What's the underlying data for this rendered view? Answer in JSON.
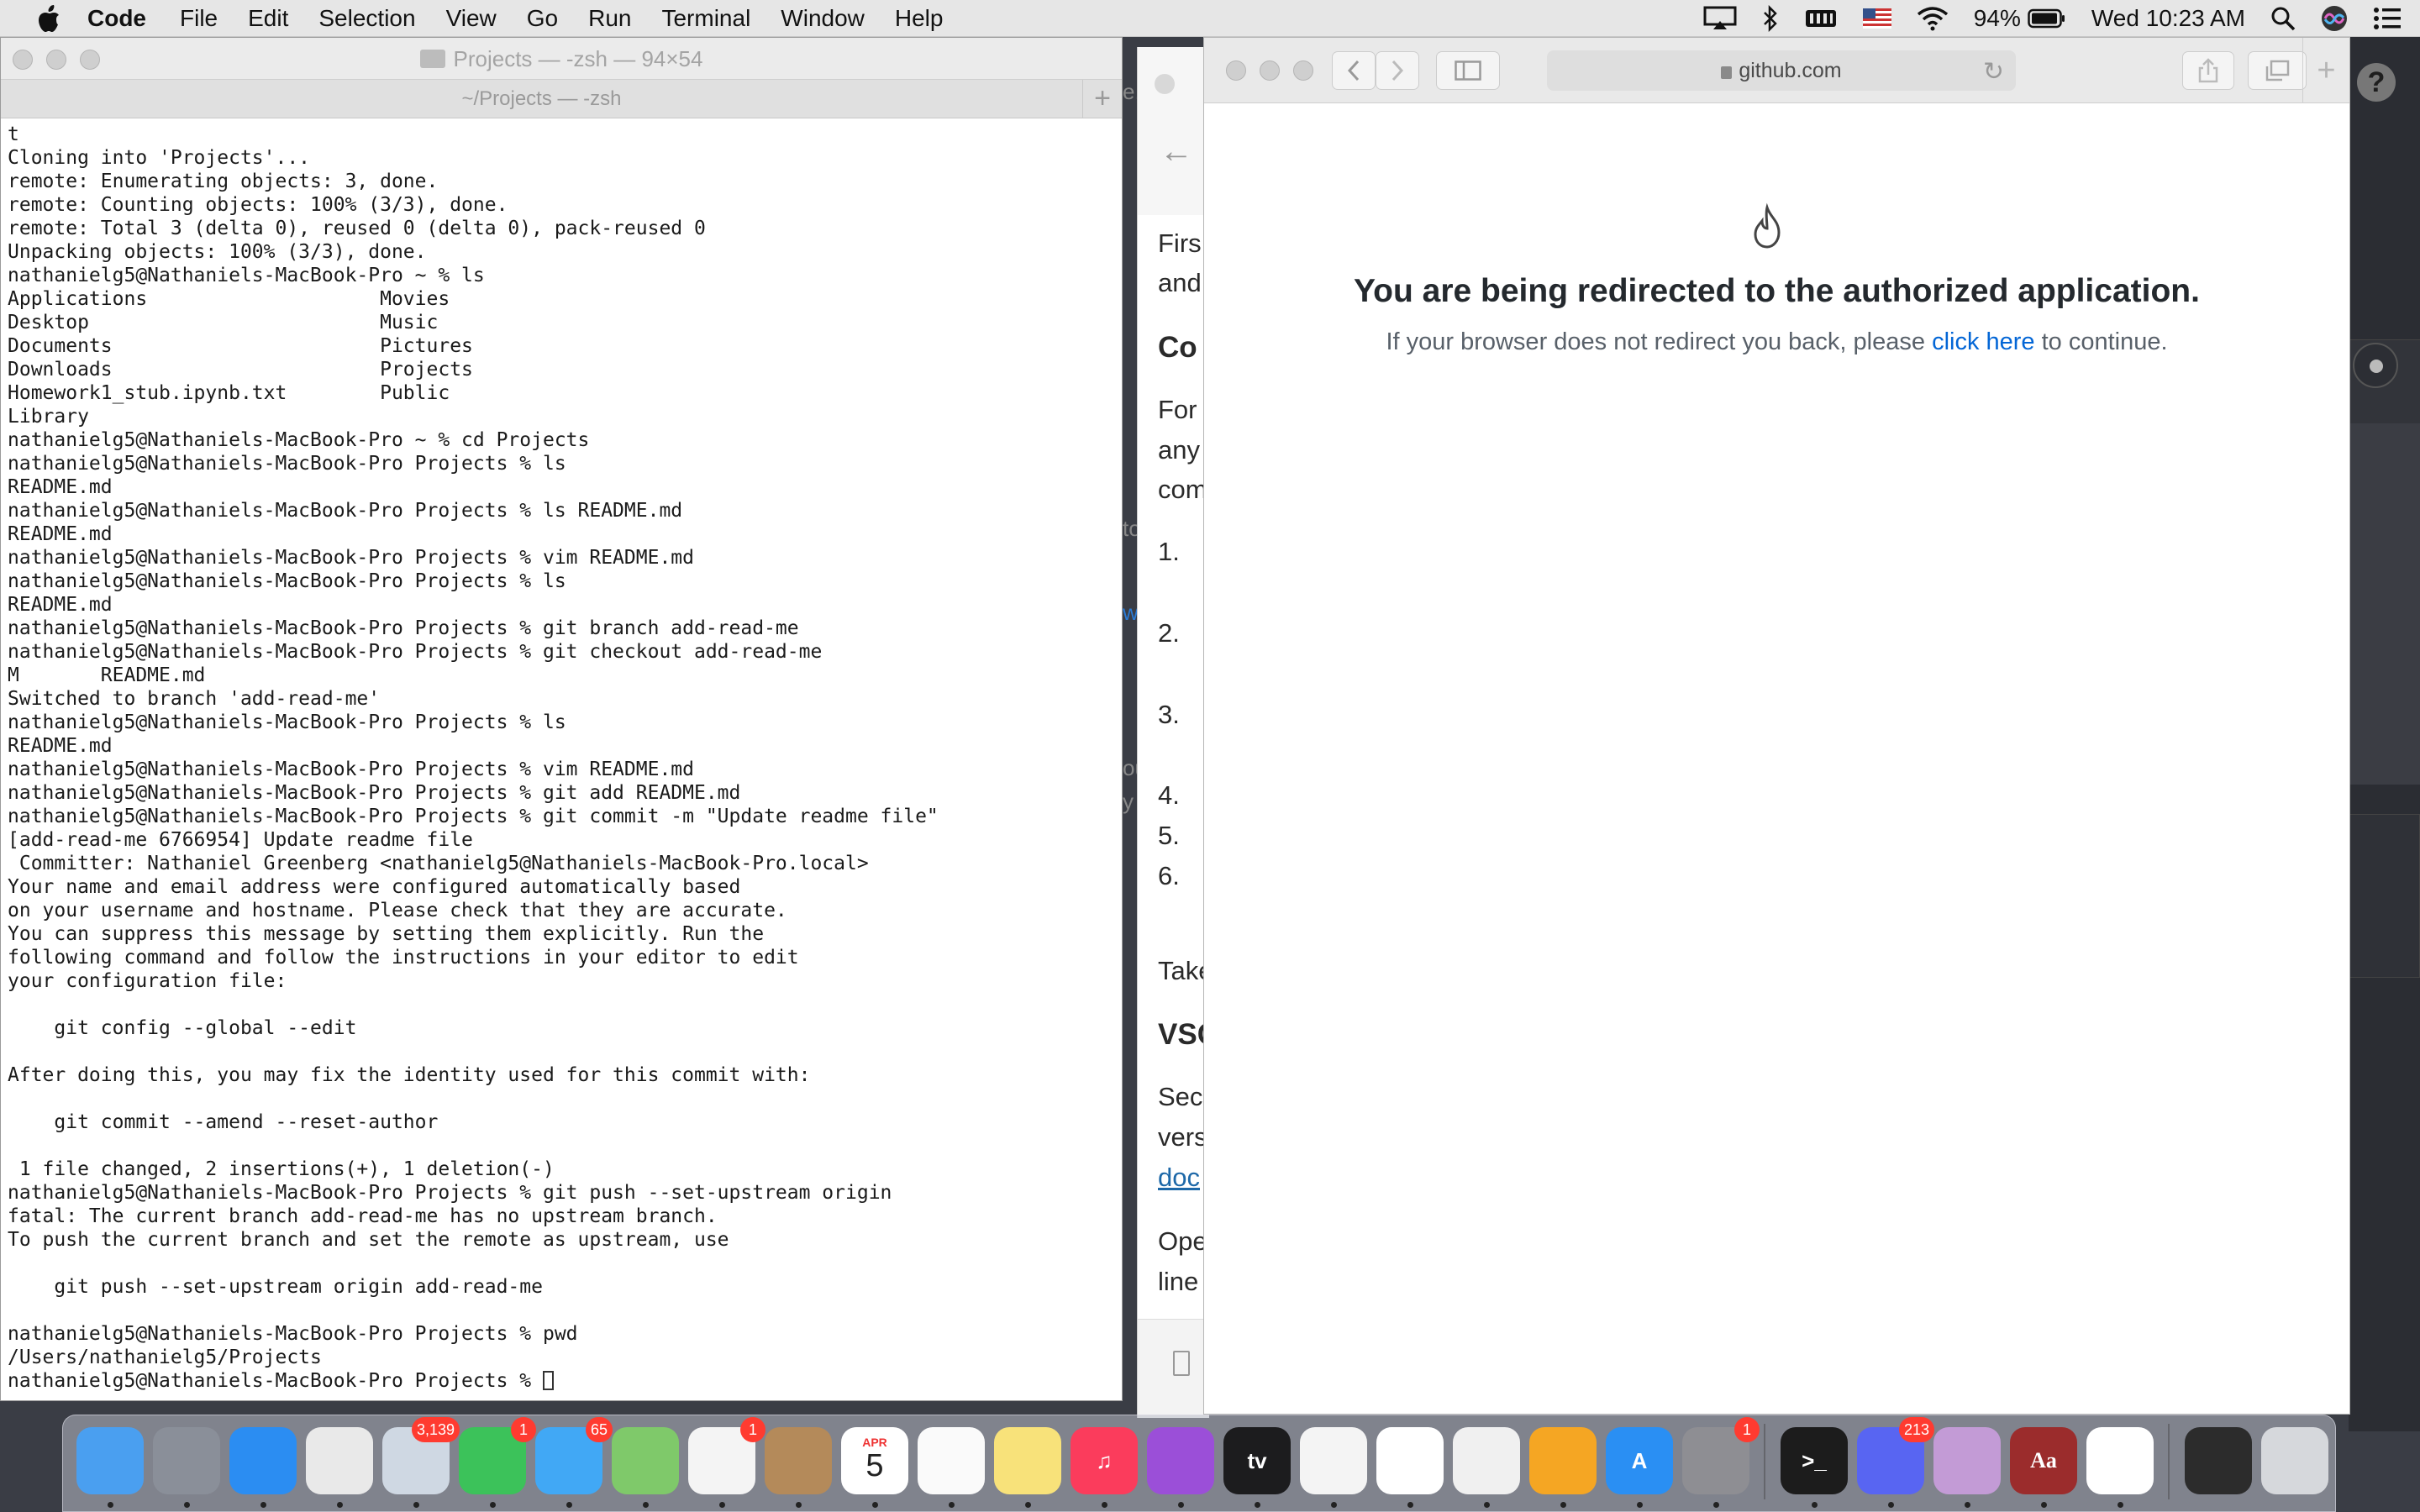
{
  "menubar": {
    "app_name": "Code",
    "items": [
      "File",
      "Edit",
      "Selection",
      "View",
      "Go",
      "Run",
      "Terminal",
      "Window",
      "Help"
    ],
    "battery": "94%",
    "clock": "Wed 10:23 AM"
  },
  "terminal": {
    "title": "Projects — -zsh — 94×54",
    "tab_title": "~/Projects — -zsh",
    "lines": [
      "t",
      "Cloning into 'Projects'...",
      "remote: Enumerating objects: 3, done.",
      "remote: Counting objects: 100% (3/3), done.",
      "remote: Total 3 (delta 0), reused 0 (delta 0), pack-reused 0",
      "Unpacking objects: 100% (3/3), done.",
      "nathanielg5@Nathaniels-MacBook-Pro ~ % ls",
      "Applications                    Movies",
      "Desktop                         Music",
      "Documents                       Pictures",
      "Downloads                       Projects",
      "Homework1_stub.ipynb.txt        Public",
      "Library",
      "nathanielg5@Nathaniels-MacBook-Pro ~ % cd Projects",
      "nathanielg5@Nathaniels-MacBook-Pro Projects % ls",
      "README.md",
      "nathanielg5@Nathaniels-MacBook-Pro Projects % ls README.md",
      "README.md",
      "nathanielg5@Nathaniels-MacBook-Pro Projects % vim README.md",
      "nathanielg5@Nathaniels-MacBook-Pro Projects % ls",
      "README.md",
      "nathanielg5@Nathaniels-MacBook-Pro Projects % git branch add-read-me",
      "nathanielg5@Nathaniels-MacBook-Pro Projects % git checkout add-read-me",
      "M       README.md",
      "Switched to branch 'add-read-me'",
      "nathanielg5@Nathaniels-MacBook-Pro Projects % ls",
      "README.md",
      "nathanielg5@Nathaniels-MacBook-Pro Projects % vim README.md",
      "nathanielg5@Nathaniels-MacBook-Pro Projects % git add README.md",
      "nathanielg5@Nathaniels-MacBook-Pro Projects % git commit -m \"Update readme file\"",
      "[add-read-me 6766954] Update readme file",
      " Committer: Nathaniel Greenberg <nathanielg5@Nathaniels-MacBook-Pro.local>",
      "Your name and email address were configured automatically based",
      "on your username and hostname. Please check that they are accurate.",
      "You can suppress this message by setting them explicitly. Run the",
      "following command and follow the instructions in your editor to edit",
      "your configuration file:",
      "",
      "    git config --global --edit",
      "",
      "After doing this, you may fix the identity used for this commit with:",
      "",
      "    git commit --amend --reset-author",
      "",
      " 1 file changed, 2 insertions(+), 1 deletion(-)",
      "nathanielg5@Nathaniels-MacBook-Pro Projects % git push --set-upstream origin",
      "fatal: The current branch add-read-me has no upstream branch.",
      "To push the current branch and set the remote as upstream, use",
      "",
      "    git push --set-upstream origin add-read-me",
      "",
      "nathanielg5@Nathaniels-MacBook-Pro Projects % pwd",
      "/Users/nathanielg5/Projects",
      "nathanielg5@Nathaniels-MacBook-Pro Projects % "
    ]
  },
  "doc_window": {
    "fragments": [
      "Firs",
      "and",
      "Co",
      "For",
      "any",
      "com",
      "1.",
      "2.",
      "3.",
      "4.",
      "5.",
      "6.",
      "Take",
      "VSC",
      "Seco",
      "vers",
      "doc",
      "Ope",
      "line"
    ]
  },
  "gap_fragments": [
    "e,",
    "to",
    "w",
    "ou",
    "y"
  ],
  "browser": {
    "url": "github.com",
    "heading": "You are being redirected to the authorized application.",
    "sub_before": "If your browser does not redirect you back, please ",
    "sub_link": "click here",
    "sub_after": " to continue."
  },
  "background": {
    "help_label": "?"
  },
  "dock": {
    "apps": [
      {
        "name": "finder",
        "color": "#4a9ff0",
        "label": ""
      },
      {
        "name": "launchpad",
        "color": "#8a8f99",
        "label": ""
      },
      {
        "name": "safari",
        "color": "#2b8df2",
        "label": ""
      },
      {
        "name": "chrome",
        "color": "#e9e9e9",
        "label": ""
      },
      {
        "name": "mail",
        "color": "#cfd8e3",
        "label": "",
        "badge": "3,139"
      },
      {
        "name": "facetime",
        "color": "#3cc25a",
        "label": "",
        "badge": "1"
      },
      {
        "name": "messages",
        "color": "#41a8f5",
        "label": "",
        "badge": "65"
      },
      {
        "name": "maps",
        "color": "#7fc96a",
        "label": ""
      },
      {
        "name": "photos",
        "color": "#f4f4f4",
        "label": "",
        "badge": "1"
      },
      {
        "name": "contacts",
        "color": "#b48a5a",
        "label": ""
      },
      {
        "name": "calendar",
        "color": "#ffffff",
        "label": "5",
        "month": "APR"
      },
      {
        "name": "reminders",
        "color": "#fafafa",
        "label": ""
      },
      {
        "name": "notes",
        "color": "#f8e27a",
        "label": ""
      },
      {
        "name": "music",
        "color": "#fb3c5c",
        "label": "♫"
      },
      {
        "name": "podcasts",
        "color": "#9b4fd8",
        "label": ""
      },
      {
        "name": "tv",
        "color": "#1c1c1e",
        "label": "tv"
      },
      {
        "name": "news",
        "color": "#f4f4f4",
        "label": ""
      },
      {
        "name": "numbers",
        "color": "#ffffff",
        "label": ""
      },
      {
        "name": "keynote",
        "color": "#f0f0f0",
        "label": ""
      },
      {
        "name": "pages",
        "color": "#f5a623",
        "label": ""
      },
      {
        "name": "app-store",
        "color": "#2a8ff3",
        "label": "A"
      },
      {
        "name": "system-preferences",
        "color": "#8e8e93",
        "label": "",
        "badge": "1"
      },
      {
        "name": "terminal",
        "color": "#1c1c1c",
        "label": ">_"
      },
      {
        "name": "discord",
        "color": "#5865f2",
        "label": "",
        "badge": "213"
      },
      {
        "name": "potion",
        "color": "#c39bd6",
        "label": ""
      },
      {
        "name": "dictionary",
        "color": "#9b2c2c",
        "label": "Aa"
      },
      {
        "name": "vscode",
        "color": "#ffffff",
        "label": ""
      },
      {
        "name": "minimized-terminal",
        "color": "#2c2c2c",
        "label": ""
      },
      {
        "name": "trash",
        "color": "#d6d8dc",
        "label": ""
      }
    ]
  }
}
